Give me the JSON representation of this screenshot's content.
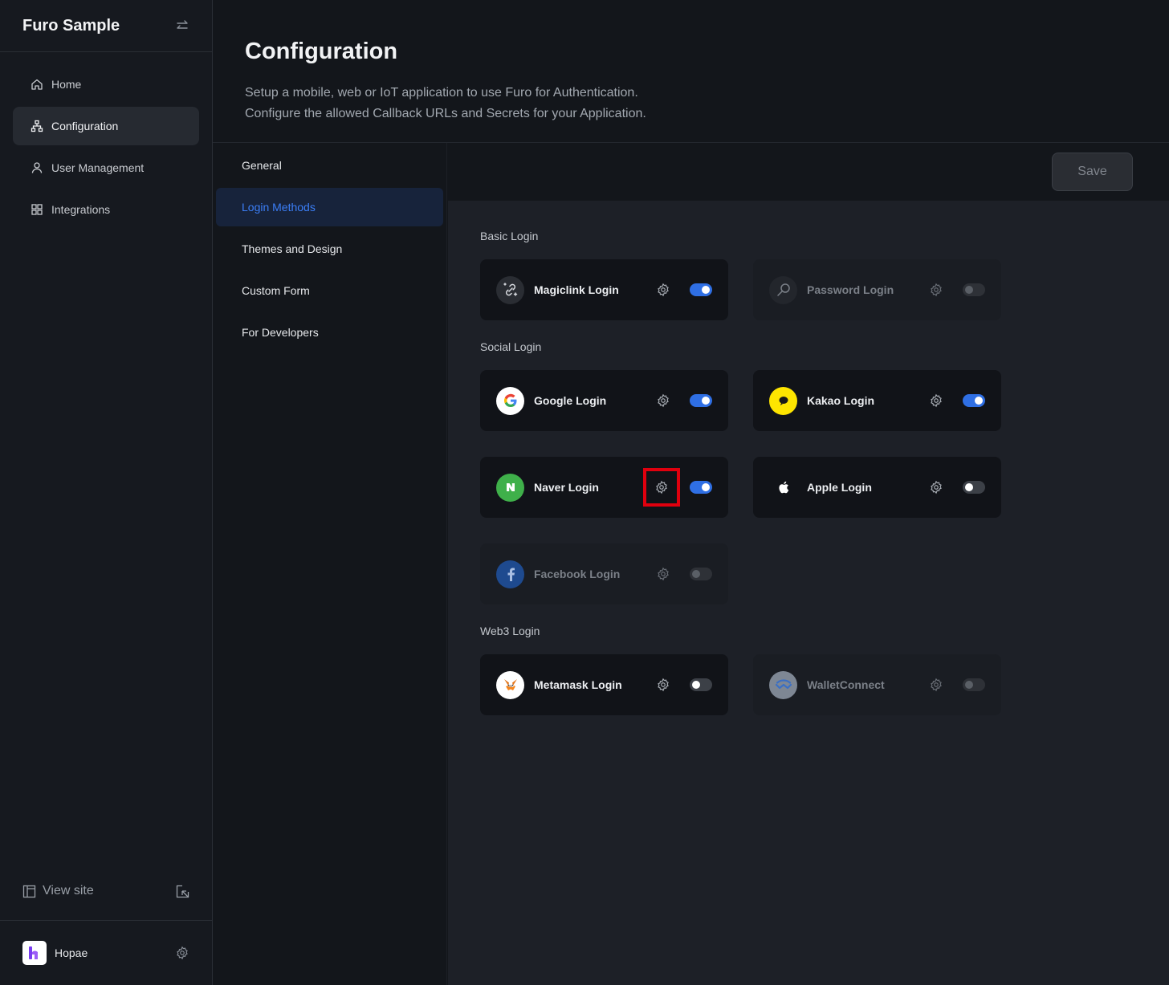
{
  "sidebar": {
    "app_title": "Furo Sample",
    "nav": [
      {
        "label": "Home",
        "icon": "home-icon",
        "active": false
      },
      {
        "label": "Configuration",
        "icon": "sitemap-icon",
        "active": true
      },
      {
        "label": "User Management",
        "icon": "user-icon",
        "active": false
      },
      {
        "label": "Integrations",
        "icon": "grid-icon",
        "active": false
      }
    ],
    "view_site": "View site",
    "user_name": "Hopae"
  },
  "header": {
    "title": "Configuration",
    "desc_line1": "Setup a mobile, web or IoT application to use Furo for Authentication.",
    "desc_line2": "Configure the allowed Callback URLs and Secrets for your Application."
  },
  "subnav": [
    {
      "label": "General",
      "active": false
    },
    {
      "label": "Login Methods",
      "active": true
    },
    {
      "label": "Themes and Design",
      "active": false
    },
    {
      "label": "Custom Form",
      "active": false
    },
    {
      "label": "For Developers",
      "active": false
    }
  ],
  "toolbar": {
    "save_label": "Save"
  },
  "sections": {
    "basic": {
      "title": "Basic Login",
      "cards": [
        {
          "label": "Magiclink Login",
          "icon": "magic-link-icon",
          "enabled": true,
          "available": true
        },
        {
          "label": "Password Login",
          "icon": "key-icon",
          "enabled": false,
          "available": false
        }
      ]
    },
    "social": {
      "title": "Social Login",
      "cards": [
        {
          "label": "Google Login",
          "icon": "google-icon",
          "enabled": true,
          "available": true
        },
        {
          "label": "Kakao Login",
          "icon": "kakao-icon",
          "enabled": true,
          "available": true
        },
        {
          "label": "Naver Login",
          "icon": "naver-icon",
          "enabled": true,
          "available": true
        },
        {
          "label": "Apple Login",
          "icon": "apple-icon",
          "enabled": false,
          "available": true
        },
        {
          "label": "Facebook Login",
          "icon": "facebook-icon",
          "enabled": false,
          "available": false
        }
      ]
    },
    "web3": {
      "title": "Web3 Login",
      "cards": [
        {
          "label": "Metamask Login",
          "icon": "metamask-icon",
          "enabled": false,
          "available": true
        },
        {
          "label": "WalletConnect",
          "icon": "walletconnect-icon",
          "enabled": false,
          "available": false
        }
      ]
    }
  },
  "colors": {
    "accent": "#2f6fe4",
    "highlight": "#e0000e",
    "google_bg": "#ffffff",
    "kakao_bg": "#fee500",
    "naver_bg": "#03c75a",
    "facebook_bg": "#1877f2"
  }
}
